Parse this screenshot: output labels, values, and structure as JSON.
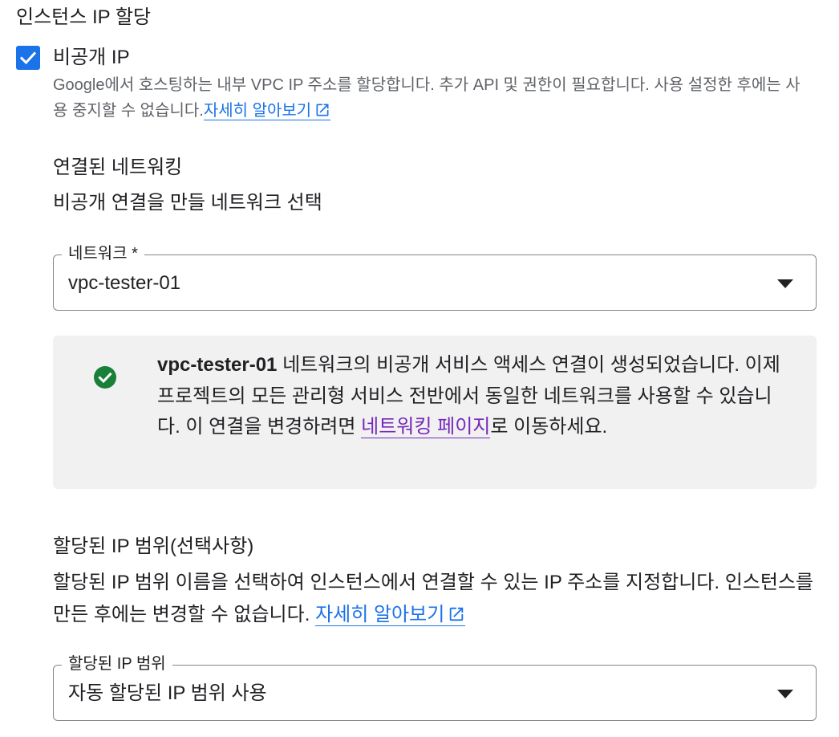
{
  "section": {
    "title": "인스턴스 IP 할당"
  },
  "private_ip": {
    "checked": true,
    "label": "비공개 IP",
    "helper_text": "Google에서 호스팅하는 내부 VPC IP 주소를 할당합니다. 추가 API 및 권한이 필요합니다. 사용 설정한 후에는 사용 중지할 수 없습니다.",
    "learn_more": "자세히 알아보기"
  },
  "connected_networking": {
    "title": "연결된 네트워킹",
    "description": "비공개 연결을 만들 네트워크 선택"
  },
  "network_select": {
    "label": "네트워크 *",
    "value": "vpc-tester-01"
  },
  "info_box": {
    "network_name": "vpc-tester-01",
    "text_1": " 네트워크의 비공개 서비스 액세스 연결이 생성되었습니다. 이제 프로젝트의 모든 관리형 서비스 전반에서 동일한 네트워크를 사용할 수 있습니다. 이 연결을 변경하려면 ",
    "link": "네트워킹 페이지",
    "text_2": "로 이동하세요.",
    "status_color": "#188038"
  },
  "allocated_range": {
    "title": "할당된 IP 범위(선택사항)",
    "description": "할당된 IP 범위 이름을 선택하여 인스턴스에서 연결할 수 있는 IP 주소를 지정합니다. 인스턴스를 만든 후에는 변경할 수 없습니다. ",
    "learn_more": "자세히 알아보기"
  },
  "range_select": {
    "label": "할당된 IP 범위",
    "value": "자동 할당된 IP 범위 사용"
  },
  "colors": {
    "accent": "#1a73e8",
    "visited_link": "#7627bb",
    "info_bg": "#f1f1f1"
  }
}
